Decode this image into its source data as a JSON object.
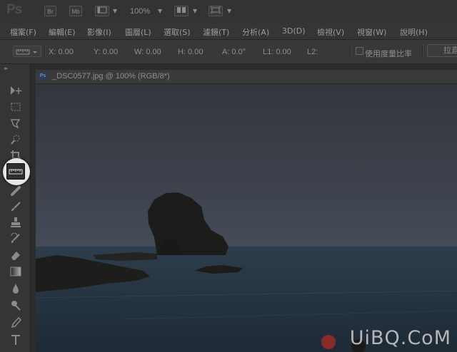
{
  "app_bar": {
    "logo": "Ps",
    "bridge_button": "Br",
    "minibridge_button": "Mb",
    "zoom_level": "100%"
  },
  "menu": {
    "items": [
      "檔案(F)",
      "編輯(E)",
      "影像(I)",
      "圖層(L)",
      "選取(S)",
      "濾鏡(T)",
      "分析(A)",
      "3D(D)",
      "檢視(V)",
      "視窗(W)",
      "說明(H)"
    ]
  },
  "options_bar": {
    "x": "X: 0.00",
    "y": "Y: 0.00",
    "w": "W: 0.00",
    "h": "H: 0.00",
    "a": "A: 0.0°",
    "l1": "L1: 0.00",
    "l2": "L2:",
    "use_measurement_scale": "使用度量比率",
    "straighten_button": "拉直"
  },
  "document": {
    "title": "_DSC0577.jpg @ 100% (RGB/8*)",
    "badge": "Ps"
  },
  "watermark": "UiBQ.CoM",
  "colors": {
    "accent_badge": "#2c3e58",
    "highlight_ring": "#e6e6e6"
  }
}
